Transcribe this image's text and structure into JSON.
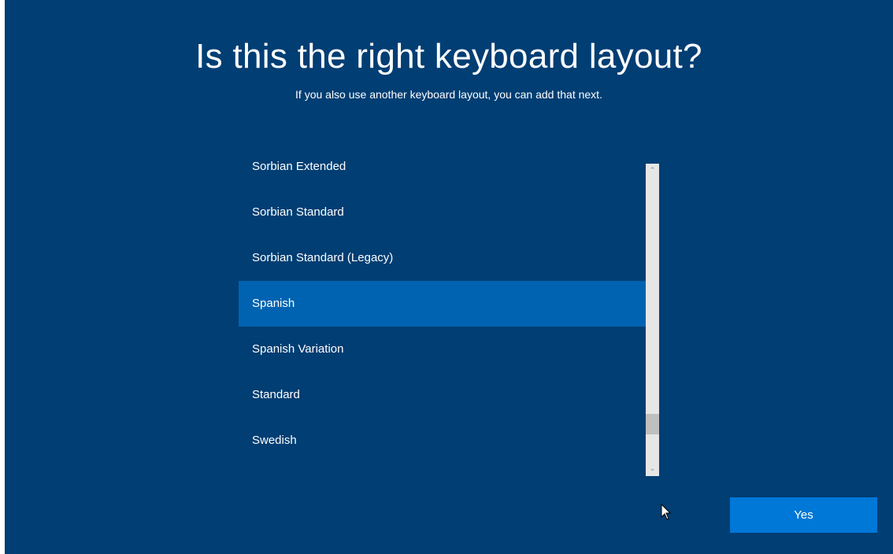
{
  "header": {
    "title": "Is this the right keyboard layout?",
    "subtitle": "If you also use another keyboard layout, you can add that next."
  },
  "layout_list": {
    "items": [
      {
        "label": "Sorbian Extended",
        "selected": false
      },
      {
        "label": "Sorbian Standard",
        "selected": false
      },
      {
        "label": "Sorbian Standard (Legacy)",
        "selected": false
      },
      {
        "label": "Spanish",
        "selected": true
      },
      {
        "label": "Spanish Variation",
        "selected": false
      },
      {
        "label": "Standard",
        "selected": false
      },
      {
        "label": "Swedish",
        "selected": false
      }
    ],
    "selected_label": "Spanish"
  },
  "scrollbar": {
    "up_icon": "chevron-up-icon",
    "down_icon": "chevron-down-icon"
  },
  "footer": {
    "yes_label": "Yes"
  },
  "colors": {
    "background": "#003e73",
    "selected_item": "#0063b1",
    "primary_button": "#0078d7",
    "scrollbar_track": "#e6e6e6",
    "scrollbar_thumb": "#bfbfbf"
  }
}
